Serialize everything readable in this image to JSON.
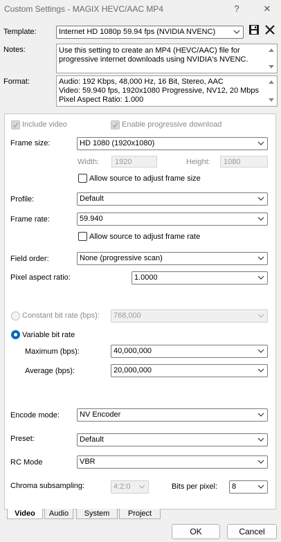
{
  "window": {
    "title": "Custom Settings - MAGIX HEVC/AAC MP4",
    "help": "?",
    "close": "✕"
  },
  "template": {
    "label": "Template:",
    "value": "Internet HD 1080p 59.94 fps (NVIDIA NVENC)"
  },
  "notes": {
    "label": "Notes:",
    "text": "Use this setting to create an MP4 (HEVC/AAC) file for\nprogressive internet downloads using NVIDIA's NVENC."
  },
  "format": {
    "label": "Format:",
    "text": "Audio: 192 Kbps, 48,000 Hz, 16 Bit, Stereo, AAC\nVideo: 59.940 fps, 1920x1080 Progressive, NV12, 20 Mbps\nPixel Aspect Ratio: 1.000"
  },
  "video": {
    "include_video": "Include video",
    "enable_progressive": "Enable progressive download",
    "frame_size_label": "Frame size:",
    "frame_size_value": "HD 1080 (1920x1080)",
    "width_label": "Width:",
    "width_value": "1920",
    "height_label": "Height:",
    "height_value": "1080",
    "allow_frame_size": "Allow source to adjust frame size",
    "profile_label": "Profile:",
    "profile_value": "Default",
    "frame_rate_label": "Frame rate:",
    "frame_rate_value": "59.940",
    "allow_frame_rate": "Allow source to adjust frame rate",
    "field_order_label": "Field order:",
    "field_order_value": "None (progressive scan)",
    "par_label": "Pixel aspect ratio:",
    "par_value": "1.0000",
    "cbr_label": "Constant bit rate (bps):",
    "cbr_value": "768,000",
    "vbr_label": "Variable bit rate",
    "max_label": "Maximum (bps):",
    "max_value": "40,000,000",
    "avg_label": "Average (bps):",
    "avg_value": "20,000,000",
    "encode_mode_label": "Encode mode:",
    "encode_mode_value": "NV Encoder",
    "preset_label": "Preset:",
    "preset_value": "Default",
    "rc_mode_label": "RC Mode",
    "rc_mode_value": "VBR",
    "chroma_label": "Chroma subsampling:",
    "chroma_value": "4:2:0",
    "bpp_label": "Bits per pixel:",
    "bpp_value": "8"
  },
  "tabs": [
    "Video",
    "Audio",
    "System",
    "Project"
  ],
  "buttons": {
    "ok": "OK",
    "cancel": "Cancel"
  },
  "colors": {
    "accent": "#0067c0",
    "disabled_text": "#8a8a8a"
  }
}
